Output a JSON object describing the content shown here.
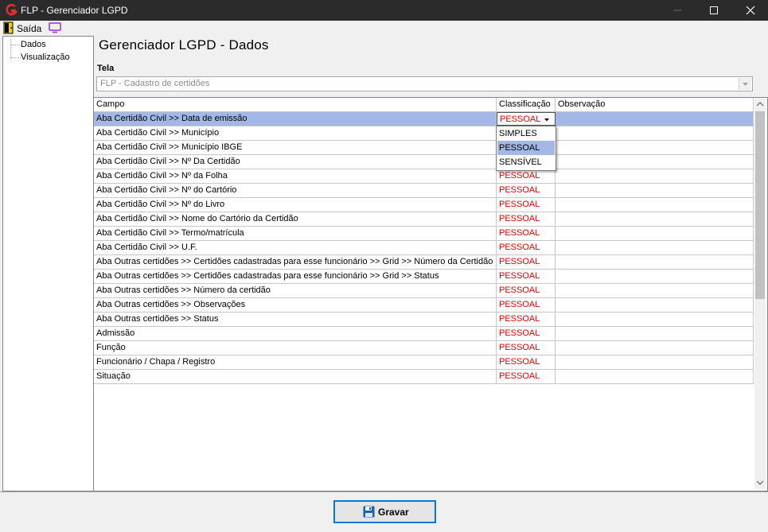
{
  "window": {
    "title": "FLP - Gerenciador LGPD"
  },
  "toolbar": {
    "exit_label": "Saída"
  },
  "tree": {
    "items": [
      {
        "label": "Dados"
      },
      {
        "label": "Visualização"
      }
    ]
  },
  "main": {
    "title": "Gerenciador LGPD - Dados",
    "tela_label": "Tela",
    "tela_value": "FLP - Cadastro de certidões"
  },
  "grid": {
    "columns": [
      "Campo",
      "Classificação",
      "Observação"
    ],
    "rows": [
      {
        "campo": "Aba Certidão Civil >> Data de emissão",
        "classificacao": "PESSOAL",
        "observacao": ""
      },
      {
        "campo": "Aba Certidão Civil >> Município",
        "classificacao": "",
        "observacao": ""
      },
      {
        "campo": "Aba Certidão Civil >> Município IBGE",
        "classificacao": "",
        "observacao": ""
      },
      {
        "campo": "Aba Certidão Civil >> Nº Da Certidão",
        "classificacao": "",
        "observacao": ""
      },
      {
        "campo": "Aba Certidão Civil >> Nº da Folha",
        "classificacao": "PESSOAL",
        "observacao": ""
      },
      {
        "campo": "Aba Certidão Civil >> Nº do Cartório",
        "classificacao": "PESSOAL",
        "observacao": ""
      },
      {
        "campo": "Aba Certidão Civil >> Nº do Livro",
        "classificacao": "PESSOAL",
        "observacao": ""
      },
      {
        "campo": "Aba Certidão Civil >> Nome do Cartório da Certidão",
        "classificacao": "PESSOAL",
        "observacao": ""
      },
      {
        "campo": "Aba Certidão Civil >> Termo/matrícula",
        "classificacao": "PESSOAL",
        "observacao": ""
      },
      {
        "campo": "Aba Certidão Civil >> U.F.",
        "classificacao": "PESSOAL",
        "observacao": ""
      },
      {
        "campo": "Aba Outras certidões >> Certidões cadastradas para esse funcionário >> Grid >> Número da Certidão",
        "classificacao": "PESSOAL",
        "observacao": ""
      },
      {
        "campo": "Aba Outras certidões >> Certidões cadastradas para esse funcionário >> Grid >> Status",
        "classificacao": "PESSOAL",
        "observacao": ""
      },
      {
        "campo": "Aba Outras certidões >> Número da certidão",
        "classificacao": "PESSOAL",
        "observacao": ""
      },
      {
        "campo": "Aba Outras certidões >> Observações",
        "classificacao": "PESSOAL",
        "observacao": ""
      },
      {
        "campo": "Aba Outras certidões >> Status",
        "classificacao": "PESSOAL",
        "observacao": ""
      },
      {
        "campo": "Admissão",
        "classificacao": "PESSOAL",
        "observacao": ""
      },
      {
        "campo": "Função",
        "classificacao": "PESSOAL",
        "observacao": ""
      },
      {
        "campo": "Funcionário / Chapa / Registro",
        "classificacao": "PESSOAL",
        "observacao": ""
      },
      {
        "campo": "Situação",
        "classificacao": "PESSOAL",
        "observacao": ""
      }
    ],
    "dropdown_options": [
      "SIMPLES",
      "PESSOAL",
      "SENSÍVEL"
    ],
    "dropdown_highlighted": "PESSOAL"
  },
  "footer": {
    "save_label": "Gravar"
  },
  "colors": {
    "titlebar": "#2b2b2b",
    "selection": "#a3b8e6",
    "classification_text": "#e00000",
    "button_focus": "#0078d7"
  },
  "icons": {
    "app": "flp-logo-icon",
    "exit": "exit-door-icon",
    "screen": "monitor-icon",
    "save": "floppy-disk-icon"
  }
}
